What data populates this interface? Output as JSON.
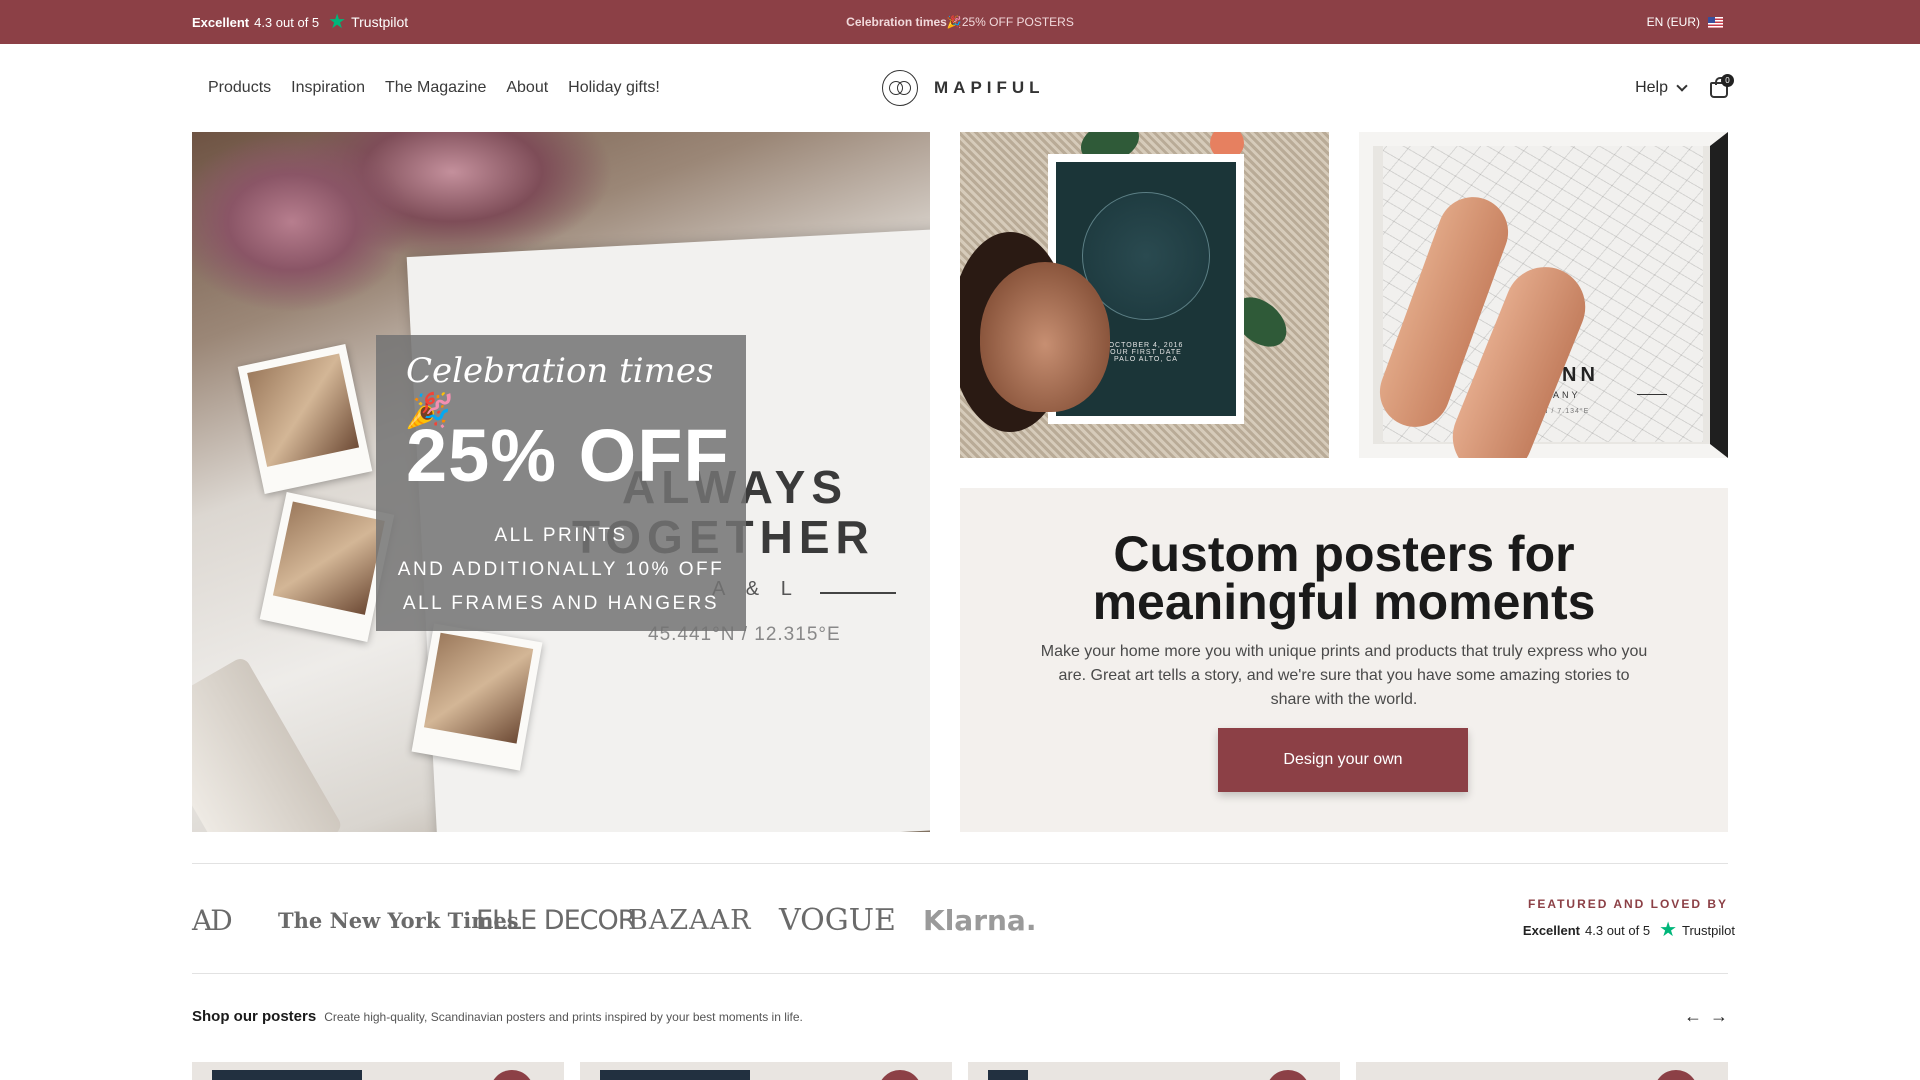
{
  "topbar": {
    "rating_label": "Excellent",
    "rating_text": "4.3 out of 5",
    "trustpilot": "Trustpilot",
    "promo_bold": "Celebration times",
    "promo_emoji": "🎉",
    "promo_text": " 25% OFF POSTERS",
    "locale": "EN (EUR)"
  },
  "header": {
    "nav": [
      "Products",
      "Inspiration",
      "The Magazine",
      "About",
      "Holiday gifts!"
    ],
    "logo": "MAPIFUL",
    "help": "Help",
    "cart_count": "0"
  },
  "hero": {
    "script_title": "Celebration times🎉",
    "discount": "25% OFF",
    "line1": "ALL PRINTS",
    "line2": "AND ADDITIONALLY 10% OFF",
    "line3": "ALL FRAMES AND HANGERS",
    "poster_line1": "ALWAYS",
    "poster_line2": "TOGETHER",
    "poster_initials": "A & L",
    "poster_coords": "45.441°N / 12.315°E"
  },
  "side_images": {
    "star_map_date": "OCTOBER 4, 2016",
    "star_map_sub": "OUR FIRST DATE",
    "star_map_place": "PALO ALTO, CA",
    "city": "BONN",
    "country": "ERMANY",
    "city_coords": "809°N / 7.134°E"
  },
  "info": {
    "title_line1": "Custom posters for",
    "title_line2": "meaningful moments",
    "description": "Make your home more you with unique prints and products that truly express who you are. Great art tells a story, and we're sure that you have some amazing stories to share with the world.",
    "button": "Design your own"
  },
  "press": {
    "logos": [
      "AD",
      "The New York Times",
      "ELLE DECOR",
      "BAZAAR",
      "VOGUE",
      "Klarna."
    ],
    "featured_label": "FEATURED AND LOVED BY",
    "rating_label": "Excellent",
    "rating_text": "4.3 out of 5",
    "trustpilot": "Trustpilot"
  },
  "shop": {
    "title": "Shop our posters",
    "description": "Create high-quality, Scandinavian posters and prints inspired by your best moments in life.",
    "prev": "←",
    "next": "→"
  },
  "colors": {
    "brand": "#8c4046",
    "trustpilot_green": "#00b67a",
    "card_bg": "#f3f0ed"
  },
  "icons": {
    "trustpilot_star": "star-icon",
    "flag": "us-flag-icon",
    "dropdown": "chevron-down-icon",
    "cart": "shopping-bag-icon"
  }
}
